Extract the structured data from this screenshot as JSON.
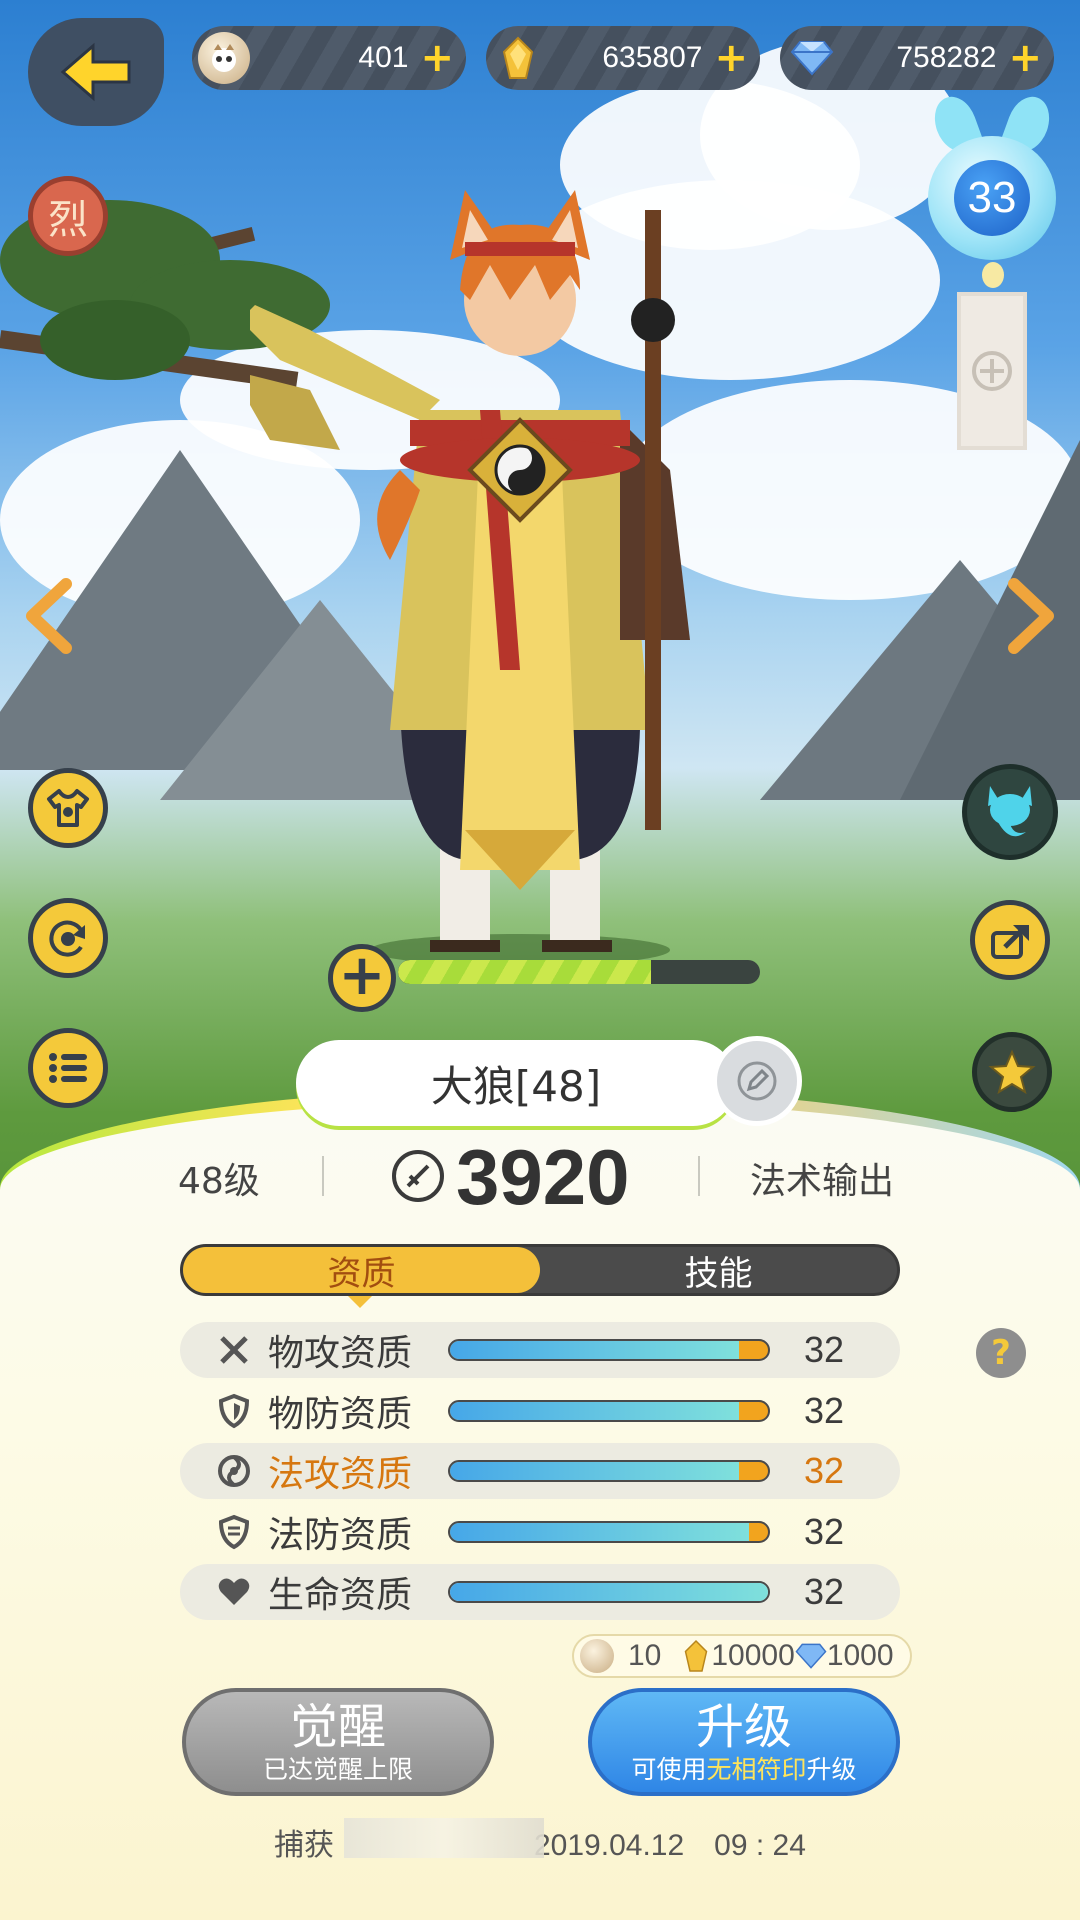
{
  "currencies": [
    {
      "name": "pet-coin",
      "value": "401",
      "plus": "+"
    },
    {
      "name": "gold",
      "value": "635807",
      "plus": "+"
    },
    {
      "name": "diamond",
      "value": "758282",
      "plus": "+"
    }
  ],
  "lantern_level": "33",
  "side_badge": "烈",
  "pet": {
    "name": "大狼[48]",
    "level": "48级",
    "power": "3920",
    "role": "法术输出",
    "exp_progress": 0.7
  },
  "tabs": [
    {
      "label": "资质",
      "active": true
    },
    {
      "label": "技能",
      "active": false
    }
  ],
  "attributes": [
    {
      "label": "物攻资质",
      "value": "32",
      "fill": 0.91,
      "icon": "crossed-swords-icon"
    },
    {
      "label": "物防资质",
      "value": "32",
      "fill": 0.91,
      "icon": "shield-icon"
    },
    {
      "label": "法攻资质",
      "value": "32",
      "fill": 0.91,
      "icon": "magic-swirl-icon"
    },
    {
      "label": "法防资质",
      "value": "32",
      "fill": 0.94,
      "icon": "magic-shield-icon"
    },
    {
      "label": "生命资质",
      "value": "32",
      "fill": 1.0,
      "icon": "heart-icon"
    }
  ],
  "cost": {
    "pet_coin": "10",
    "gold": "10000",
    "diamond": "1000"
  },
  "awaken": {
    "label": "觉醒",
    "sub": "已达觉醒上限"
  },
  "upgrade": {
    "label": "升级",
    "sub_pre": "可使用",
    "sub_hl": "无相符印",
    "sub_post": "升级"
  },
  "capture": {
    "prefix": "捕获",
    "date": "2019.04.12　09 : 24"
  },
  "help": "?",
  "colors": {
    "accent": "#f4c93a",
    "highlight": "#d6770f",
    "blue": "#2f86e6"
  }
}
